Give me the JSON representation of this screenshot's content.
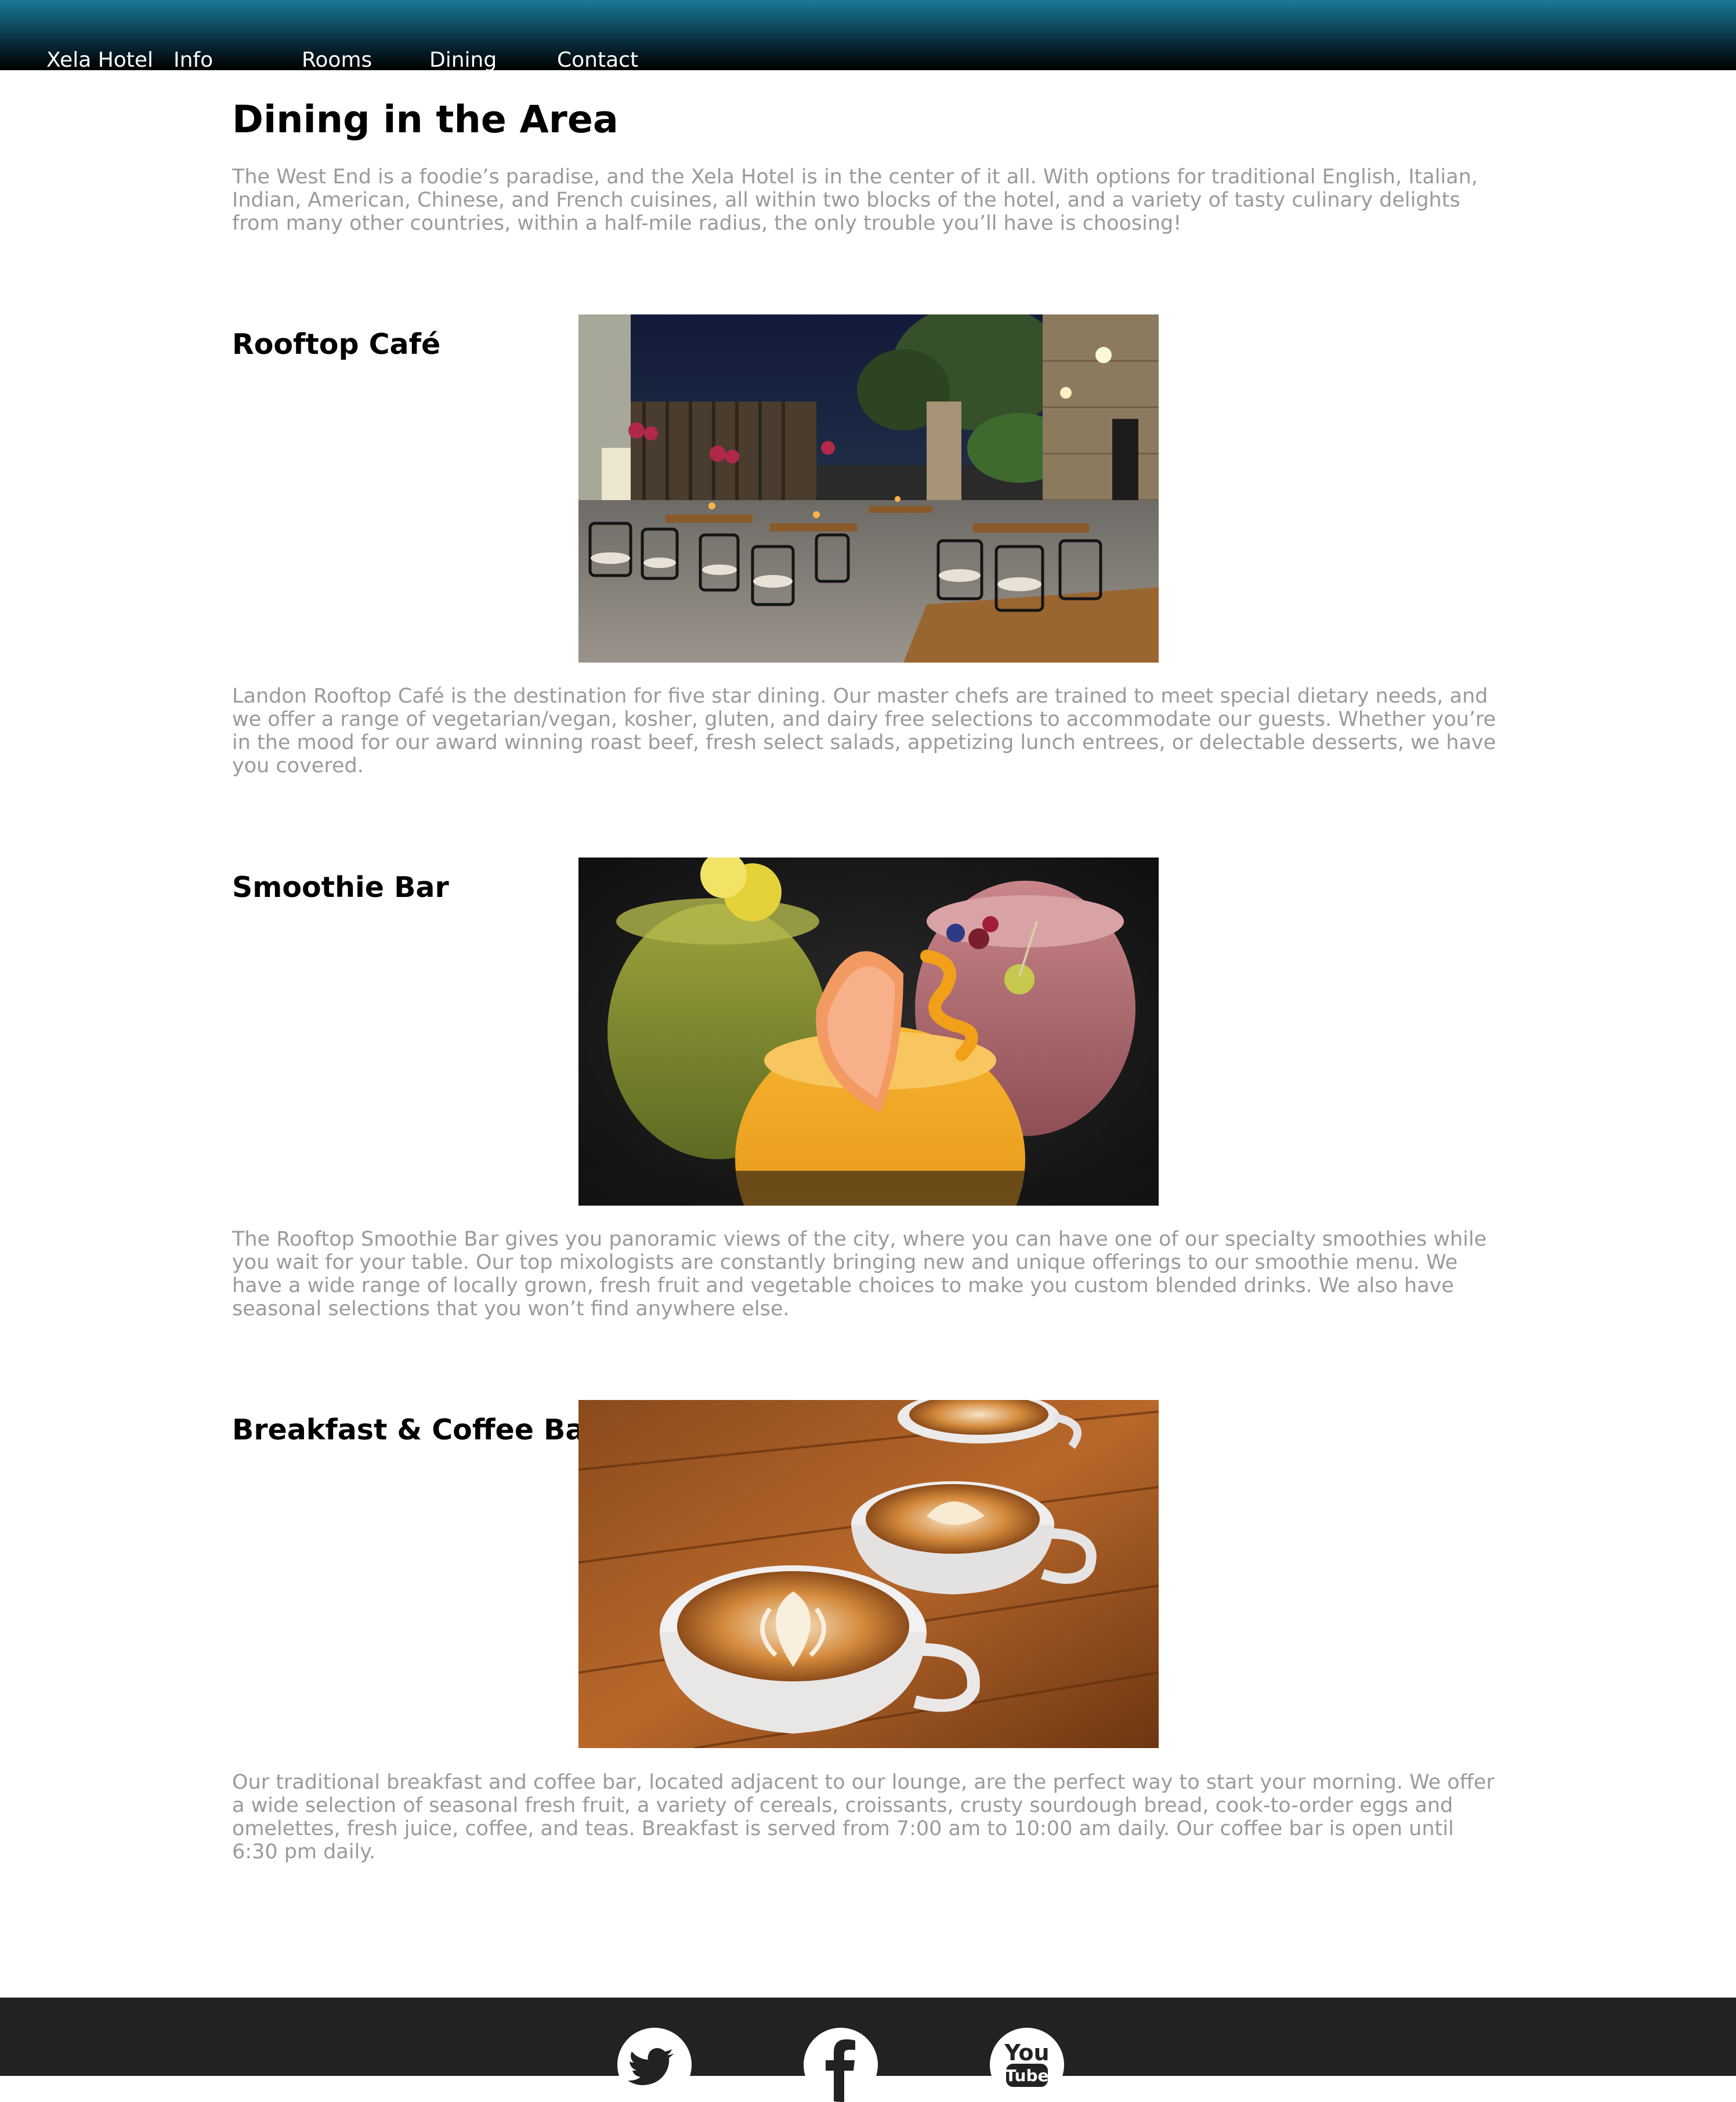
{
  "nav": {
    "brand": "Xela Hotel",
    "items": [
      "Info",
      "Rooms",
      "Dining",
      "Contact"
    ]
  },
  "page": {
    "title": "Dining in the Area",
    "intro": "The West End is a foodie’s paradise, and the Xela Hotel is in the center of it all. With options for traditional English, Italian, Indian, American, Chinese, and French cuisines, all within two blocks of the hotel, and a variety of tasty culinary delights from many other countries, within a half-mile radius, the only trouble you’ll have is choosing!"
  },
  "sections": [
    {
      "title": "Rooftop Café",
      "text": "Landon Rooftop Café is the destination for five star dining. Our master chefs are trained to meet special dietary needs, and we offer a range of vegetarian/vegan, kosher, gluten, and dairy free selections to accommodate our guests. Whether you’re in the mood for our award winning roast beef, fresh select salads, appetizing lunch entrees, or delectable desserts, we have you covered."
    },
    {
      "title": "Smoothie Bar",
      "text": "The Rooftop Smoothie Bar gives you panoramic views of the city, where you can have one of our specialty smoothies while you wait for your table. Our top mixologists are constantly bringing new and unique offerings to our smoothie menu. We have a wide range of locally grown, fresh fruit and vegetable choices to make you custom blended drinks. We also have seasonal selections that you won’t find anywhere else."
    },
    {
      "title": "Breakfast & Coffee Bar",
      "text": "Our traditional breakfast and coffee bar, located adjacent to our lounge, are the perfect way to start your morning. We offer a wide selection of seasonal fresh fruit, a variety of cereals, croissants, crusty sourdough bread, cook-to-order eggs and omelettes, fresh juice, coffee, and teas. Breakfast is served from 7:00 am to 10:00 am daily. Our coffee bar is open until 6:30 pm daily."
    }
  ],
  "footer": {
    "social_icons": [
      "twitter-icon",
      "facebook-icon",
      "youtube-icon"
    ],
    "youtube_label": "You",
    "youtube_tube": "Tube"
  },
  "colors": {
    "nav_top": "#1b7a97",
    "nav_bottom": "#000000",
    "body_text": "#9a9a9a",
    "footer_bg": "#222222"
  }
}
